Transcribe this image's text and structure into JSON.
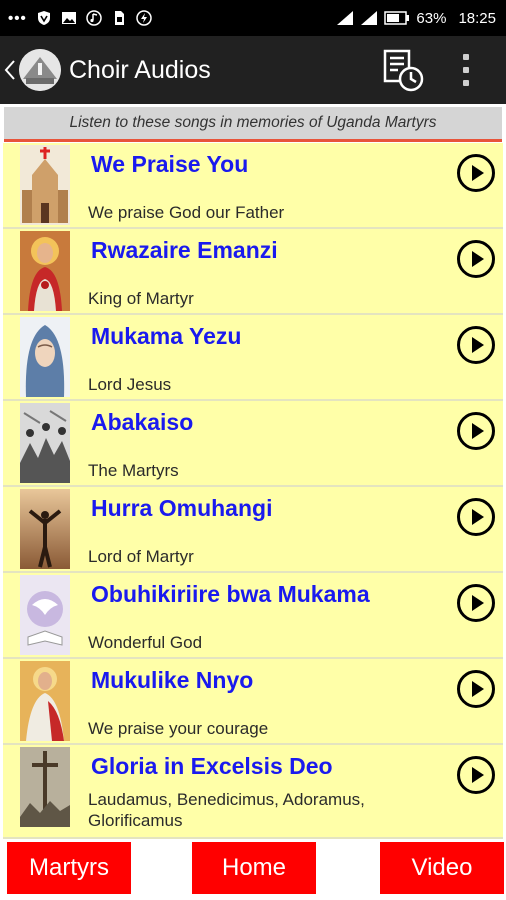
{
  "status_bar": {
    "battery": "63%",
    "time": "18:25"
  },
  "app_bar": {
    "title": "Choir Audios"
  },
  "banner": "Listen to these songs in memories of Uganda Martyrs",
  "songs": [
    {
      "title": "We Praise You",
      "subtitle": "We praise God our Father",
      "thumb": "church-image"
    },
    {
      "title": "Rwazaire Emanzi",
      "subtitle": "King of Martyr",
      "thumb": "sacred-heart-image"
    },
    {
      "title": "Mukama Yezu",
      "subtitle": "Lord Jesus",
      "thumb": "mary-image"
    },
    {
      "title": "Abakaiso",
      "subtitle": "The Martyrs",
      "thumb": "martyrs-image"
    },
    {
      "title": "Hurra Omuhangi",
      "subtitle": "Lord of Martyr",
      "thumb": "praise-silhouette-image"
    },
    {
      "title": "Obuhikiriire bwa Mukama",
      "subtitle": "Wonderful God",
      "thumb": "dove-bible-image"
    },
    {
      "title": "Mukulike Nnyo",
      "subtitle": "We praise your courage",
      "thumb": "jesus-image"
    },
    {
      "title": "Gloria in Excelsis Deo",
      "subtitle": "Laudamus, Benedicimus, Adoramus, Glorificamus",
      "thumb": "crucifixion-image"
    }
  ],
  "bottom_nav": {
    "martyrs": "Martyrs",
    "home": "Home",
    "video": "Video"
  },
  "colors": {
    "list_bg": "#ffffa8",
    "title_blue": "#1a1aee",
    "nav_red": "#ff0000",
    "banner_underline": "#e8543a"
  }
}
